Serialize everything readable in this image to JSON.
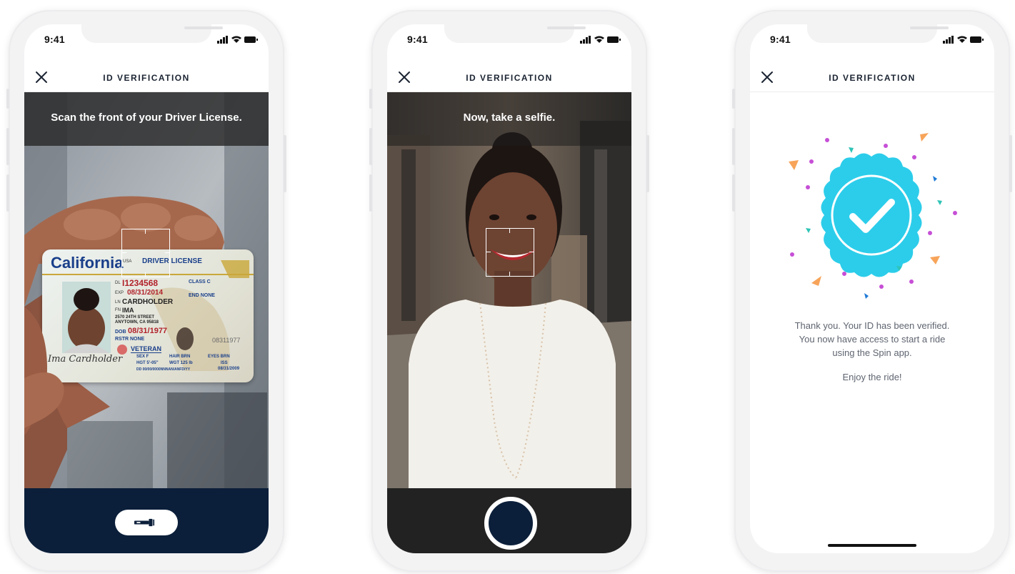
{
  "colors": {
    "navy": "#0b1f3a",
    "dark_bar": "#222222",
    "badge": "#2ccdea",
    "text_dark": "#1b2432",
    "text_body": "#5f6570"
  },
  "screens": [
    {
      "status": {
        "time": "9:41"
      },
      "header": {
        "title": "ID VERIFICATION",
        "close_icon": "close-icon"
      },
      "banner": "Scan the front of your Driver License.",
      "bottom": {
        "button_icon": "flashlight-icon"
      },
      "license": {
        "state": "California",
        "country": "USA",
        "type": "DRIVER LICENSE",
        "dl_label": "DL",
        "dl_number": "I1234568",
        "class": "CLASS C",
        "exp_label": "EXP",
        "exp": "08/31/2014",
        "end": "END NONE",
        "ln_label": "LN",
        "last_name": "CARDHOLDER",
        "fn_label": "FN",
        "first_name": "IMA",
        "address1": "2570 24TH STREET",
        "address2": "ANYTOWN, CA 95818",
        "dob_label": "DOB",
        "dob": "08/31/1977",
        "rstr": "RSTR NONE",
        "dob_short": "08311977",
        "veteran": "VETERAN",
        "sex": "SEX F",
        "hair": "HAIR BRN",
        "eyes": "EYES BRN",
        "hgt": "HGT 5'-05\"",
        "wgt": "WGT 125 lb",
        "iss_label": "ISS",
        "iss": "08/31/2009",
        "dd": "DD 00/00/0000NNNAN/ANFD/YY",
        "signature": "Ima Cardholder"
      }
    },
    {
      "status": {
        "time": "9:41"
      },
      "header": {
        "title": "ID VERIFICATION",
        "close_icon": "close-icon"
      },
      "banner": "Now, take a selfie.",
      "bottom": {
        "button_icon": "shutter-button"
      }
    },
    {
      "status": {
        "time": "9:41"
      },
      "header": {
        "title": "ID VERIFICATION",
        "close_icon": "close-icon"
      },
      "badge_icon": "verified-check-badge-icon",
      "message": {
        "line1": "Thank you. Your ID has been verified.",
        "line2": "You now have access to start a ride",
        "line3": "using the Spin app.",
        "closing": "Enjoy the ride!"
      }
    }
  ]
}
